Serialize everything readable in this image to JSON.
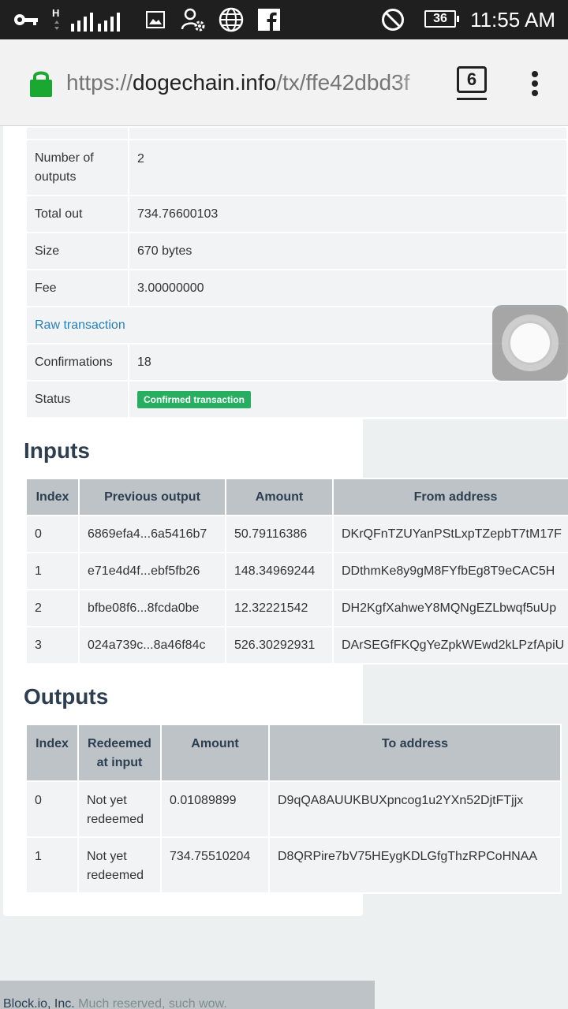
{
  "status_bar": {
    "time": "11:55 AM",
    "battery": "36",
    "network": "H",
    "icons": [
      "key-icon",
      "signal-icon",
      "image-icon",
      "user-settings-icon",
      "globe-icon",
      "facebook-icon",
      "do-not-disturb-icon"
    ]
  },
  "browser": {
    "url_scheme": "https://",
    "url_host": "dogechain.info",
    "url_path": "/tx/ffe42dbd3f",
    "tab_count": "6"
  },
  "summary": [
    {
      "label": "Number of outputs",
      "value": "2"
    },
    {
      "label": "Total out",
      "value": "734.76600103"
    },
    {
      "label": "Size",
      "value": "670 bytes"
    },
    {
      "label": "Fee",
      "value": "3.00000000"
    }
  ],
  "raw_transaction_link": "Raw transaction",
  "confirmations": {
    "label": "Confirmations",
    "value": "18"
  },
  "status": {
    "label": "Status",
    "value": "Confirmed transaction"
  },
  "inputs": {
    "title": "Inputs",
    "headers": [
      "Index",
      "Previous output",
      "Amount",
      "From address"
    ],
    "rows": [
      {
        "index": "0",
        "prev": "6869efa4...6a5416b7",
        "amount": "50.79116386",
        "from": "DKrQFnTZUYanPStLxpTZepbT7tM17F"
      },
      {
        "index": "1",
        "prev": "e71e4d4f...ebf5fb26",
        "amount": "148.34969244",
        "from": "DDthmKe8y9gM8FYfbEg8T9eCAC5H"
      },
      {
        "index": "2",
        "prev": "bfbe08f6...8fcda0be",
        "amount": "12.32221542",
        "from": "DH2KgfXahweY8MQNgEZLbwqf5uUp"
      },
      {
        "index": "3",
        "prev": "024a739c...8a46f84c",
        "amount": "526.30292931",
        "from": "DArSEGfFKQgYeZpkWEwd2kLPzfApiU"
      }
    ]
  },
  "outputs": {
    "title": "Outputs",
    "headers": [
      "Index",
      "Redeemed at input",
      "Amount",
      "To address"
    ],
    "rows": [
      {
        "index": "0",
        "redeemed": "Not yet redeemed",
        "amount": "0.01089899",
        "to": "D9qQA8AUUKBUXpncog1u2YXn52DjtFTjjx"
      },
      {
        "index": "1",
        "redeemed": "Not yet redeemed",
        "amount": "734.75510204",
        "to": "D8QRPire7bV75HEygKDLGfgThzRPCoHNAA"
      }
    ]
  },
  "footer": {
    "company": "Block.io, Inc.",
    "tagline": "Much reserved, such wow."
  }
}
